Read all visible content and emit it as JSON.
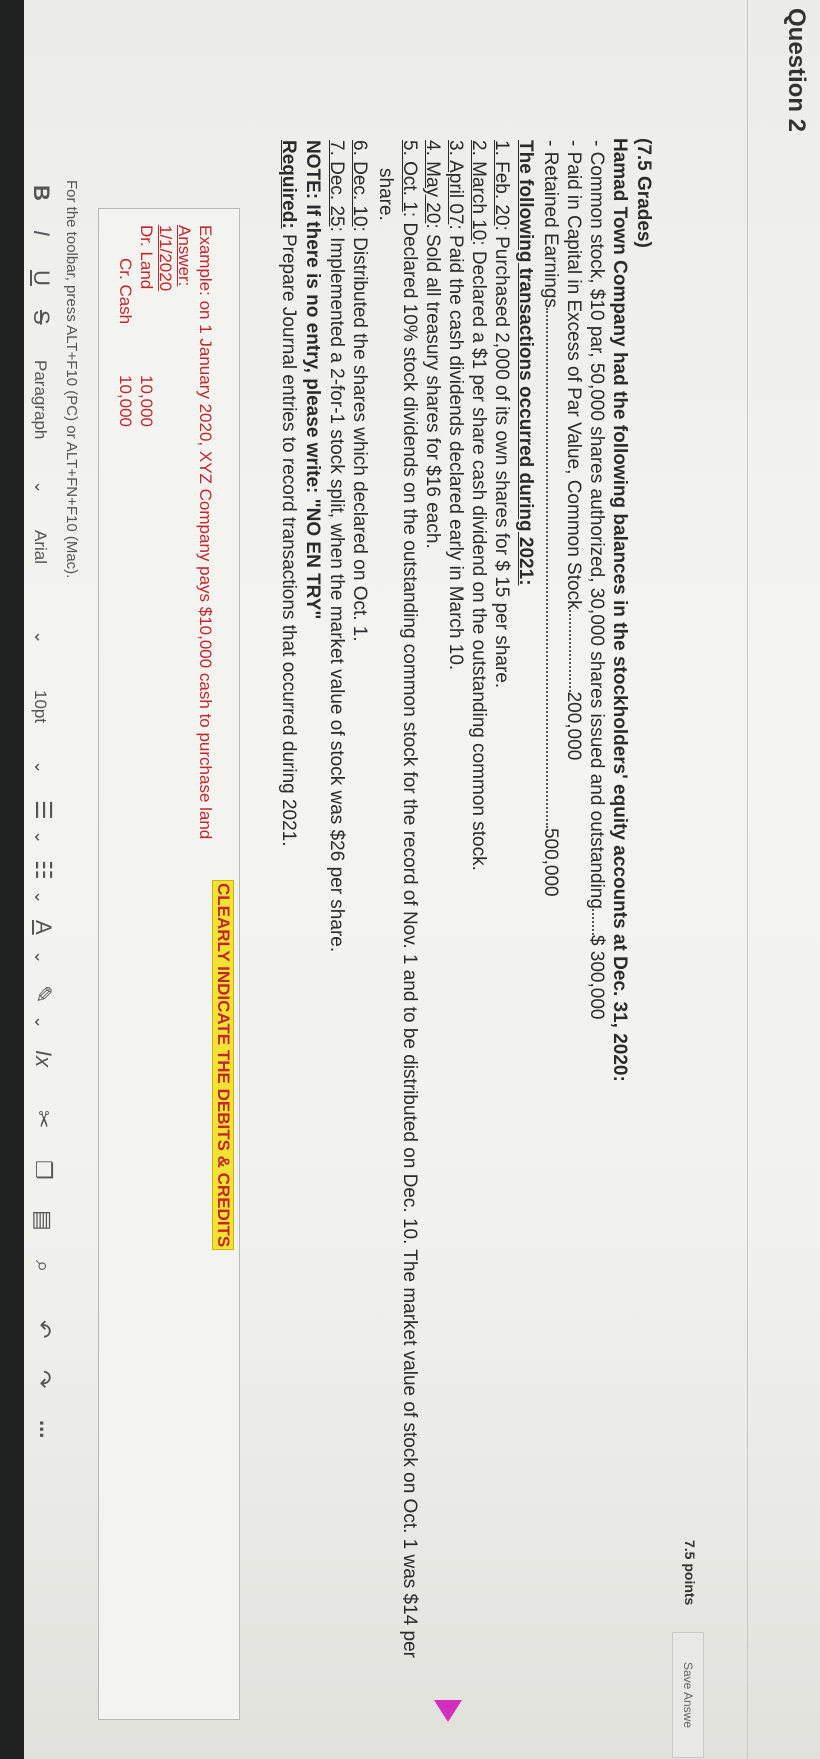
{
  "header": {
    "question_title": "Question 2",
    "points": "7.5 points",
    "save_label": "Save Answe"
  },
  "question": {
    "grades": "(7.5 Grades)",
    "intro": "Hamad Town Company had the following balances in the stockholders' equity accounts at Dec. 31, 2020:",
    "balances": [
      {
        "label": "- Common stock, $10 par, 50,000 shares authorized, 30,000 shares issued and outstanding",
        "value": "$ 300,000"
      },
      {
        "label": "- Paid in Capital in Excess of Par Value, Common Stock",
        "value": "200,000"
      },
      {
        "label": "- Retained Earnings",
        "value": "500,000"
      }
    ],
    "transactions_heading": "The following transactions occurred during 2021:",
    "transactions": [
      {
        "date": "1. Feb. 20",
        "text": ": Purchased 2,000 of its own shares for $ 15 per share."
      },
      {
        "date": "2. March 10",
        "text": ": Declared a $1 per share cash dividend on the outstanding common stock."
      },
      {
        "date": "3. April 07",
        "text": ": Paid the cash dividends declared early in March 10."
      },
      {
        "date": "4. May 20",
        "text": ": Sold all treasury shares for $16 each."
      },
      {
        "date": "5. Oct. 1",
        "text": ": Declared 10% stock dividends on the outstanding common stock for the record of Nov. 1 and to be distributed on Dec. 10. The market value of stock on Oct. 1 was $14 per"
      },
      {
        "date": "",
        "text": "share."
      },
      {
        "date": "6. Dec. 10",
        "text": ": Distributed the shares which declared on Oct. 1."
      },
      {
        "date": "7. Dec. 25",
        "text": ": Implemented a 2-for-1 stock split, when the market value of stock was $26 per share."
      }
    ],
    "note": "NOTE: If there is no entry, please write: \"NO EN TRY\"",
    "required_label": "Required:",
    "required_text": " Prepare Journal entries to record transactions that occurred during 2021."
  },
  "editor": {
    "clearly": "CLEARLY INDICATE THE DEBITS & CREDITS",
    "example": "Example: on 1 January 2020, XYZ Company pays $10,000 cash to purchase land",
    "answer_label": "Answer:",
    "date": "1/1/2020",
    "debit_account": "Dr. Land",
    "debit_amount": "10,000",
    "credit_account": "Cr. Cash",
    "credit_amount": "10,000"
  },
  "toolbar": {
    "hint": "For the toolbar, press ALT+F10 (PC) or ALT+FN+F10 (Mac).",
    "bold": "B",
    "italic": "I",
    "underline": "U",
    "strike": "S",
    "paragraph": "Paragraph",
    "font": "Arial",
    "size": "10pt",
    "more": "..."
  }
}
